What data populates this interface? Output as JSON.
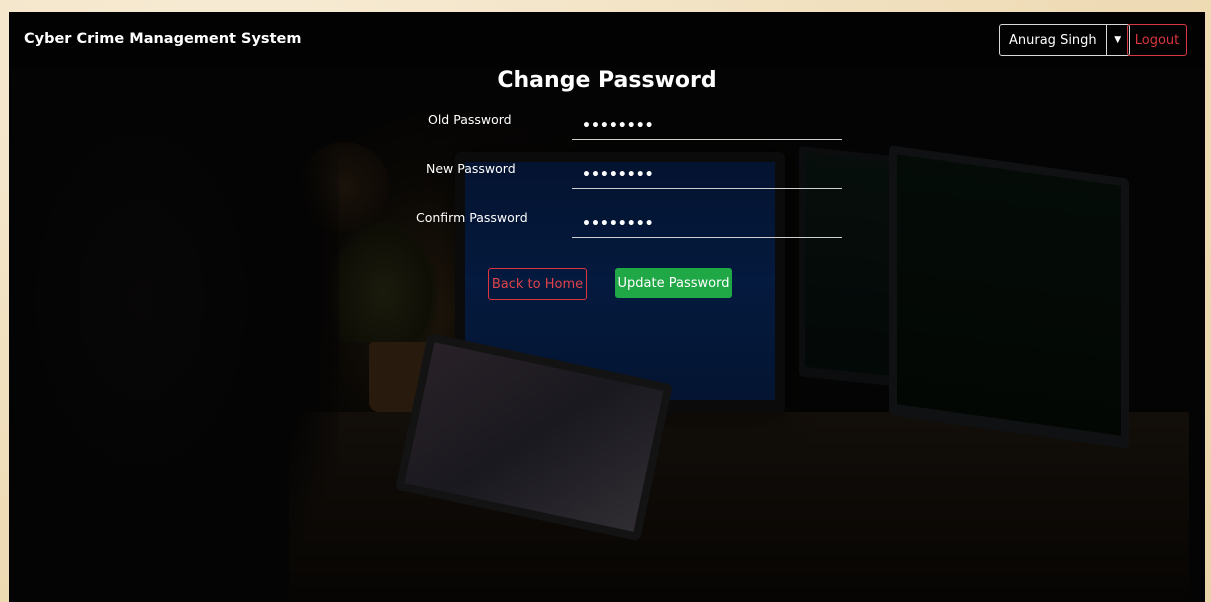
{
  "navbar": {
    "brand": "Cyber Crime Management System",
    "user_name": "Anurag Singh",
    "logout_label": "Logout"
  },
  "form": {
    "title": "Change Password",
    "fields": [
      {
        "label": "Old Password",
        "value": "••••••••"
      },
      {
        "label": "New Password",
        "value": "••••••••"
      },
      {
        "label": "Confirm Password",
        "value": "••••••••"
      }
    ],
    "back_label": "Back to Home",
    "update_label": "Update Password"
  },
  "colors": {
    "danger": "#d9363e",
    "success": "#20a847"
  },
  "icons": {
    "dropdown": "caret-down-icon"
  }
}
